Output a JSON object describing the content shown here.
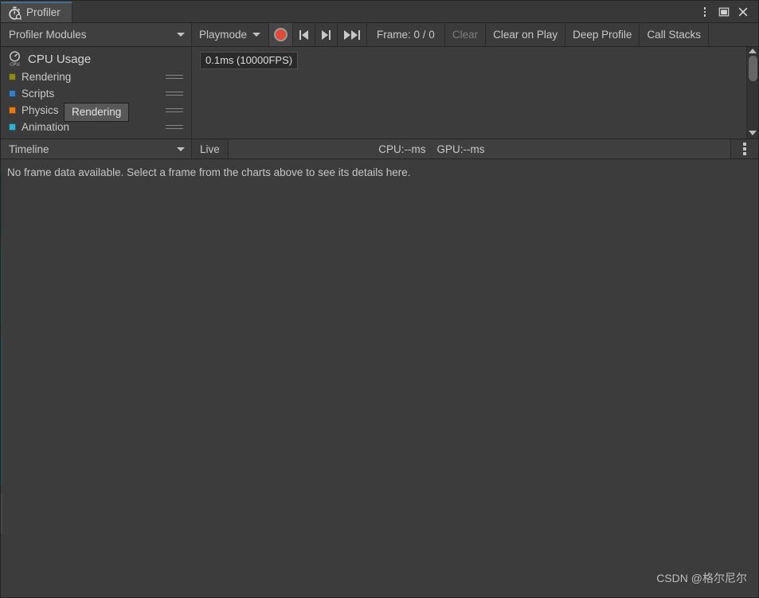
{
  "window": {
    "tab_label": "Profiler",
    "tab_icon": "stopwatch-icon",
    "menu_icon": "kebab-menu-icon",
    "maximize_icon": "maximize-icon",
    "close_icon": "close-icon"
  },
  "toolbar": {
    "modules_dropdown_label": "Profiler Modules",
    "playmode_label": "Playmode",
    "record_button": "record-button",
    "first_frame_button": "first-frame-icon",
    "prev_frame_button": "previous-frame-icon",
    "last_frame_button": "last-frame-icon",
    "frame_label": "Frame: 0 / 0",
    "clear_label": "Clear",
    "clear_on_play_label": "Clear on Play",
    "deep_profile_label": "Deep Profile",
    "call_stacks_label": "Call Stacks"
  },
  "charts": {
    "module_header": "CPU Usage",
    "module_header_icon": "cpu-gauge-icon",
    "scale_label": "0.1ms (10000FPS)",
    "tooltip_label": "Rendering",
    "modules": [
      {
        "label": "Rendering",
        "color": "#8a8a22"
      },
      {
        "label": "Scripts",
        "color": "#3a7ebf"
      },
      {
        "label": "Physics",
        "color": "#e07c1e"
      },
      {
        "label": "Animation",
        "color": "#3ab0cc"
      }
    ]
  },
  "detail_toolbar": {
    "view_dropdown_label": "Timeline",
    "live_label": "Live",
    "cpu_stat": "CPU:--ms",
    "gpu_stat": "GPU:--ms",
    "options_icon": "kebab-menu-icon"
  },
  "detail_body": {
    "empty_message": "No frame data available. Select a frame from the charts above to see its details here."
  },
  "watermark": {
    "text": "CSDN @格尔尼尔"
  }
}
